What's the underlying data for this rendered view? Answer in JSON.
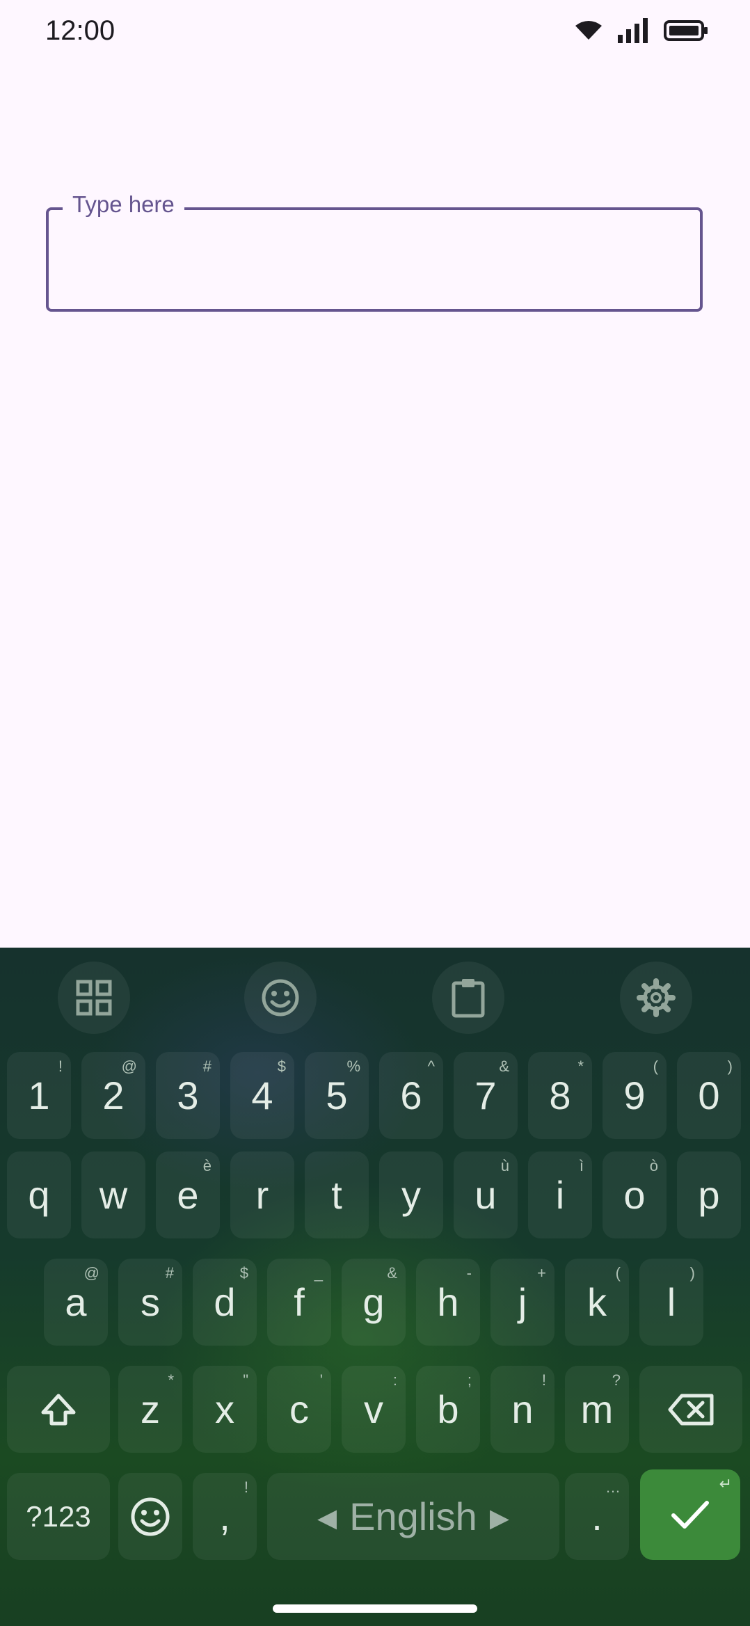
{
  "status_bar": {
    "time": "12:00",
    "icons": [
      "wifi-icon",
      "cellular-signal-icon",
      "battery-icon"
    ]
  },
  "text_field": {
    "label": "Type here",
    "value": ""
  },
  "keyboard": {
    "toolbar": [
      "apps-grid-icon",
      "emoji-icon",
      "clipboard-icon",
      "settings-icon"
    ],
    "row_numbers": [
      {
        "main": "1",
        "sup": "!"
      },
      {
        "main": "2",
        "sup": "@"
      },
      {
        "main": "3",
        "sup": "#"
      },
      {
        "main": "4",
        "sup": "$"
      },
      {
        "main": "5",
        "sup": "%"
      },
      {
        "main": "6",
        "sup": "^"
      },
      {
        "main": "7",
        "sup": "&"
      },
      {
        "main": "8",
        "sup": "*"
      },
      {
        "main": "9",
        "sup": "("
      },
      {
        "main": "0",
        "sup": ")"
      }
    ],
    "row_top": [
      {
        "main": "q",
        "sup": ""
      },
      {
        "main": "w",
        "sup": ""
      },
      {
        "main": "e",
        "sup": "è"
      },
      {
        "main": "r",
        "sup": ""
      },
      {
        "main": "t",
        "sup": ""
      },
      {
        "main": "y",
        "sup": ""
      },
      {
        "main": "u",
        "sup": "ù"
      },
      {
        "main": "i",
        "sup": "ì"
      },
      {
        "main": "o",
        "sup": "ò"
      },
      {
        "main": "p",
        "sup": ""
      }
    ],
    "row_middle": [
      {
        "main": "a",
        "sup": "@"
      },
      {
        "main": "s",
        "sup": "#"
      },
      {
        "main": "d",
        "sup": "$"
      },
      {
        "main": "f",
        "sup": "_"
      },
      {
        "main": "g",
        "sup": "&"
      },
      {
        "main": "h",
        "sup": "-"
      },
      {
        "main": "j",
        "sup": "+"
      },
      {
        "main": "k",
        "sup": "("
      },
      {
        "main": "l",
        "sup": ")"
      }
    ],
    "row_bottom": [
      {
        "main": "z",
        "sup": "*"
      },
      {
        "main": "x",
        "sup": "\""
      },
      {
        "main": "c",
        "sup": "'"
      },
      {
        "main": "v",
        "sup": ":"
      },
      {
        "main": "b",
        "sup": ";"
      },
      {
        "main": "n",
        "sup": "!"
      },
      {
        "main": "m",
        "sup": "?"
      }
    ],
    "symbols_label": "?123",
    "comma": {
      "main": ",",
      "sup": "!"
    },
    "space_label": "English",
    "period": {
      "main": ".",
      "sup": "…"
    },
    "enter_sup": "↵"
  }
}
